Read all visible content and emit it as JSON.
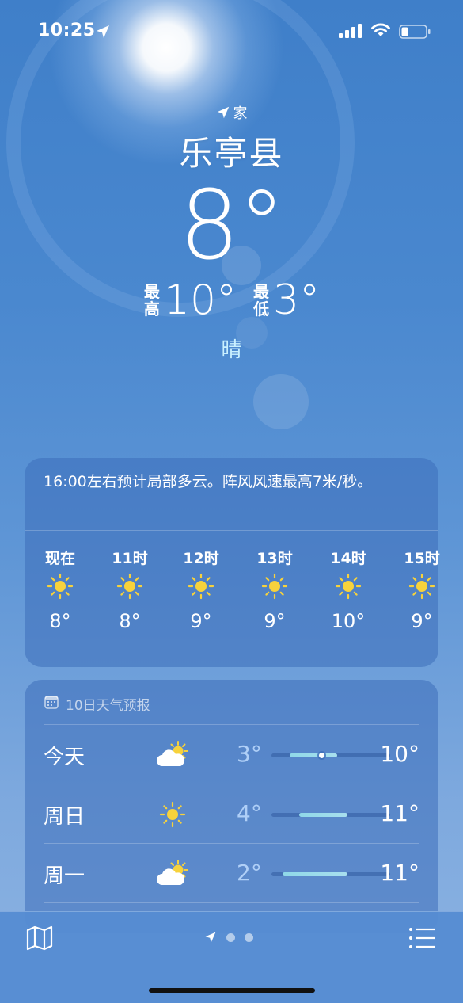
{
  "status_bar": {
    "time": "10:25"
  },
  "location": {
    "tag": "家",
    "city": "乐亭县",
    "current_temp": "8°",
    "high_label": "最高",
    "high": "10°",
    "low_label": "最低",
    "low": "3°",
    "condition": "晴"
  },
  "hourly": {
    "summary": "16:00左右预计局部多云。阵风风速最高7米/秒。",
    "items": [
      {
        "label": "现在",
        "icon": "sun-icon",
        "temp": "8°"
      },
      {
        "label": "11时",
        "icon": "sun-icon",
        "temp": "8°"
      },
      {
        "label": "12时",
        "icon": "sun-icon",
        "temp": "9°"
      },
      {
        "label": "13时",
        "icon": "sun-icon",
        "temp": "9°"
      },
      {
        "label": "14时",
        "icon": "sun-icon",
        "temp": "10°"
      },
      {
        "label": "15时",
        "icon": "sun-icon",
        "temp": "9°"
      }
    ]
  },
  "daily": {
    "title": "10日天气预报",
    "rows": [
      {
        "day": "今天",
        "icon": "partly-cloudy-icon",
        "low": "3°",
        "high": "10°",
        "range_start": 0.15,
        "range_end": 0.55,
        "current": 0.42
      },
      {
        "day": "周日",
        "icon": "sun-icon",
        "low": "4°",
        "high": "11°",
        "range_start": 0.23,
        "range_end": 0.64
      },
      {
        "day": "周一",
        "icon": "partly-cloudy-icon",
        "low": "2°",
        "high": "11°",
        "range_start": 0.09,
        "range_end": 0.64
      }
    ]
  },
  "colors": {
    "sun": "#f7d23c",
    "condition": "#c9f0ff",
    "bar_fill": "#9ad9ea"
  }
}
